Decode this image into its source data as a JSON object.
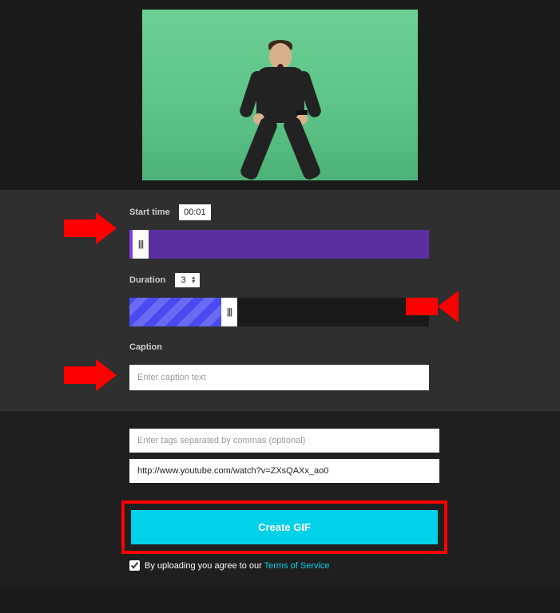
{
  "start_time": {
    "label": "Start time",
    "value": "00:01"
  },
  "duration": {
    "label": "Duration",
    "value": "3"
  },
  "caption": {
    "label": "Caption",
    "placeholder": "Enter caption text"
  },
  "tags": {
    "placeholder": "Enter tags separated by commas (optional)"
  },
  "source_url": {
    "value": "http://www.youtube.com/watch?v=ZXsQAXx_ao0"
  },
  "create_button": "Create GIF",
  "agree": {
    "checked": true,
    "text": "By uploading you agree to our",
    "link_text": "Terms of Service"
  }
}
